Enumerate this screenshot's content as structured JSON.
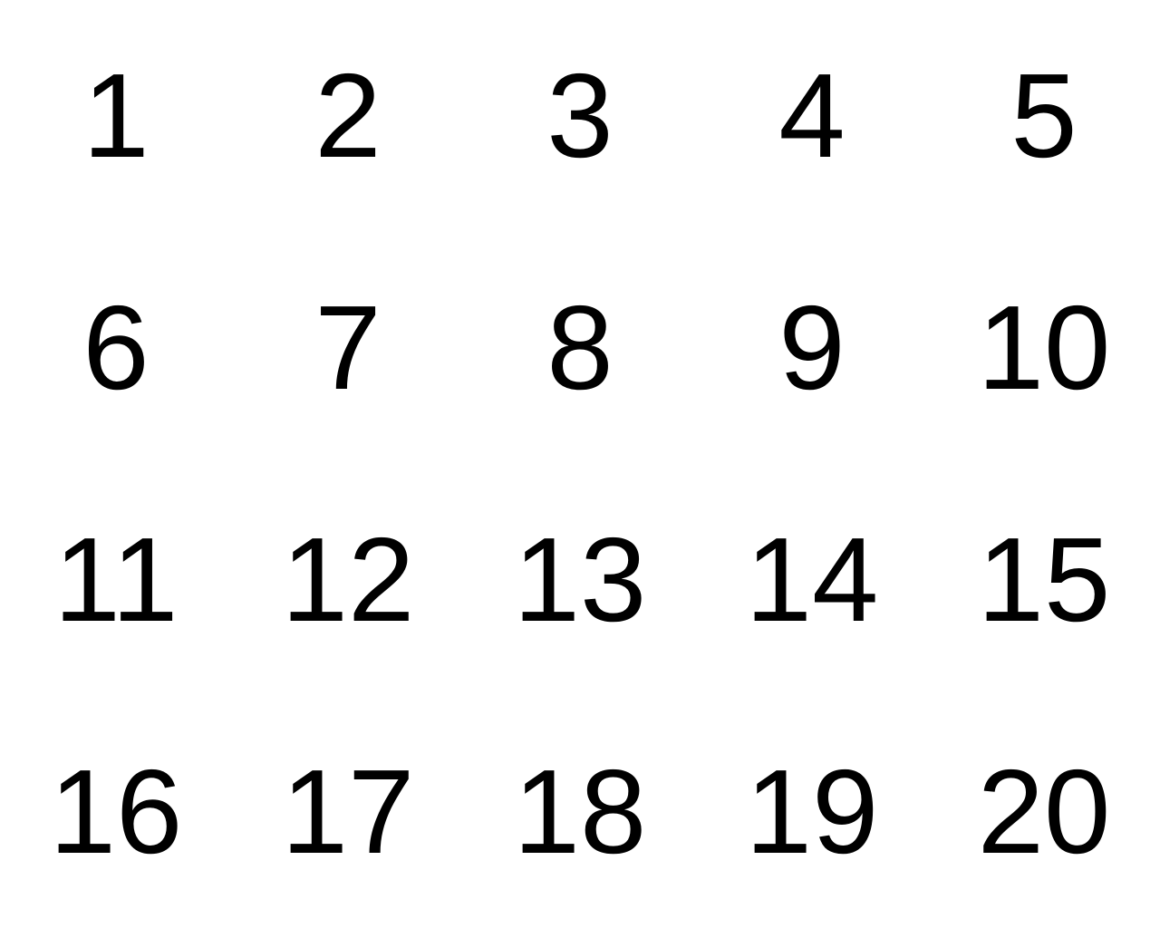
{
  "grid": {
    "numbers": [
      "1",
      "2",
      "3",
      "4",
      "5",
      "6",
      "7",
      "8",
      "9",
      "10",
      "11",
      "12",
      "13",
      "14",
      "15",
      "16",
      "17",
      "18",
      "19",
      "20"
    ]
  },
  "colors": {
    "background": "#ffffff",
    "text": "#000000"
  }
}
